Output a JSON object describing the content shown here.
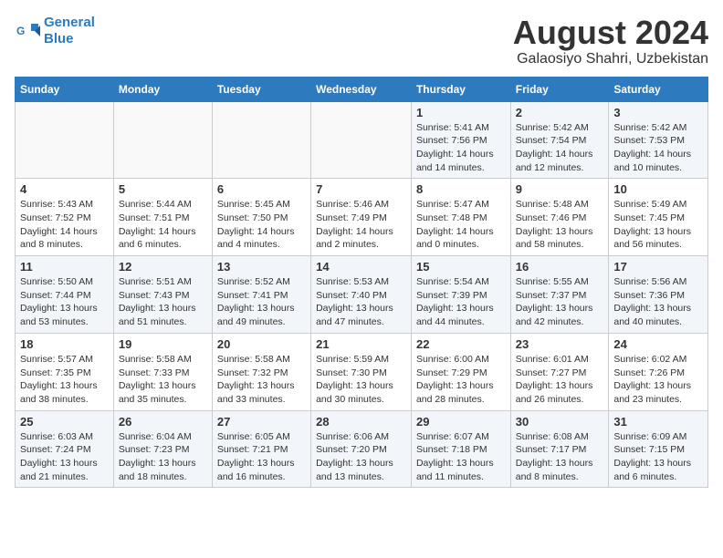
{
  "header": {
    "logo_line1": "General",
    "logo_line2": "Blue",
    "main_title": "August 2024",
    "subtitle": "Galaosiyo Shahri, Uzbekistan"
  },
  "days_of_week": [
    "Sunday",
    "Monday",
    "Tuesday",
    "Wednesday",
    "Thursday",
    "Friday",
    "Saturday"
  ],
  "weeks": [
    [
      {
        "day": "",
        "detail": ""
      },
      {
        "day": "",
        "detail": ""
      },
      {
        "day": "",
        "detail": ""
      },
      {
        "day": "",
        "detail": ""
      },
      {
        "day": "1",
        "detail": "Sunrise: 5:41 AM\nSunset: 7:56 PM\nDaylight: 14 hours and 14 minutes."
      },
      {
        "day": "2",
        "detail": "Sunrise: 5:42 AM\nSunset: 7:54 PM\nDaylight: 14 hours and 12 minutes."
      },
      {
        "day": "3",
        "detail": "Sunrise: 5:42 AM\nSunset: 7:53 PM\nDaylight: 14 hours and 10 minutes."
      }
    ],
    [
      {
        "day": "4",
        "detail": "Sunrise: 5:43 AM\nSunset: 7:52 PM\nDaylight: 14 hours and 8 minutes."
      },
      {
        "day": "5",
        "detail": "Sunrise: 5:44 AM\nSunset: 7:51 PM\nDaylight: 14 hours and 6 minutes."
      },
      {
        "day": "6",
        "detail": "Sunrise: 5:45 AM\nSunset: 7:50 PM\nDaylight: 14 hours and 4 minutes."
      },
      {
        "day": "7",
        "detail": "Sunrise: 5:46 AM\nSunset: 7:49 PM\nDaylight: 14 hours and 2 minutes."
      },
      {
        "day": "8",
        "detail": "Sunrise: 5:47 AM\nSunset: 7:48 PM\nDaylight: 14 hours and 0 minutes."
      },
      {
        "day": "9",
        "detail": "Sunrise: 5:48 AM\nSunset: 7:46 PM\nDaylight: 13 hours and 58 minutes."
      },
      {
        "day": "10",
        "detail": "Sunrise: 5:49 AM\nSunset: 7:45 PM\nDaylight: 13 hours and 56 minutes."
      }
    ],
    [
      {
        "day": "11",
        "detail": "Sunrise: 5:50 AM\nSunset: 7:44 PM\nDaylight: 13 hours and 53 minutes."
      },
      {
        "day": "12",
        "detail": "Sunrise: 5:51 AM\nSunset: 7:43 PM\nDaylight: 13 hours and 51 minutes."
      },
      {
        "day": "13",
        "detail": "Sunrise: 5:52 AM\nSunset: 7:41 PM\nDaylight: 13 hours and 49 minutes."
      },
      {
        "day": "14",
        "detail": "Sunrise: 5:53 AM\nSunset: 7:40 PM\nDaylight: 13 hours and 47 minutes."
      },
      {
        "day": "15",
        "detail": "Sunrise: 5:54 AM\nSunset: 7:39 PM\nDaylight: 13 hours and 44 minutes."
      },
      {
        "day": "16",
        "detail": "Sunrise: 5:55 AM\nSunset: 7:37 PM\nDaylight: 13 hours and 42 minutes."
      },
      {
        "day": "17",
        "detail": "Sunrise: 5:56 AM\nSunset: 7:36 PM\nDaylight: 13 hours and 40 minutes."
      }
    ],
    [
      {
        "day": "18",
        "detail": "Sunrise: 5:57 AM\nSunset: 7:35 PM\nDaylight: 13 hours and 38 minutes."
      },
      {
        "day": "19",
        "detail": "Sunrise: 5:58 AM\nSunset: 7:33 PM\nDaylight: 13 hours and 35 minutes."
      },
      {
        "day": "20",
        "detail": "Sunrise: 5:58 AM\nSunset: 7:32 PM\nDaylight: 13 hours and 33 minutes."
      },
      {
        "day": "21",
        "detail": "Sunrise: 5:59 AM\nSunset: 7:30 PM\nDaylight: 13 hours and 30 minutes."
      },
      {
        "day": "22",
        "detail": "Sunrise: 6:00 AM\nSunset: 7:29 PM\nDaylight: 13 hours and 28 minutes."
      },
      {
        "day": "23",
        "detail": "Sunrise: 6:01 AM\nSunset: 7:27 PM\nDaylight: 13 hours and 26 minutes."
      },
      {
        "day": "24",
        "detail": "Sunrise: 6:02 AM\nSunset: 7:26 PM\nDaylight: 13 hours and 23 minutes."
      }
    ],
    [
      {
        "day": "25",
        "detail": "Sunrise: 6:03 AM\nSunset: 7:24 PM\nDaylight: 13 hours and 21 minutes."
      },
      {
        "day": "26",
        "detail": "Sunrise: 6:04 AM\nSunset: 7:23 PM\nDaylight: 13 hours and 18 minutes."
      },
      {
        "day": "27",
        "detail": "Sunrise: 6:05 AM\nSunset: 7:21 PM\nDaylight: 13 hours and 16 minutes."
      },
      {
        "day": "28",
        "detail": "Sunrise: 6:06 AM\nSunset: 7:20 PM\nDaylight: 13 hours and 13 minutes."
      },
      {
        "day": "29",
        "detail": "Sunrise: 6:07 AM\nSunset: 7:18 PM\nDaylight: 13 hours and 11 minutes."
      },
      {
        "day": "30",
        "detail": "Sunrise: 6:08 AM\nSunset: 7:17 PM\nDaylight: 13 hours and 8 minutes."
      },
      {
        "day": "31",
        "detail": "Sunrise: 6:09 AM\nSunset: 7:15 PM\nDaylight: 13 hours and 6 minutes."
      }
    ]
  ]
}
